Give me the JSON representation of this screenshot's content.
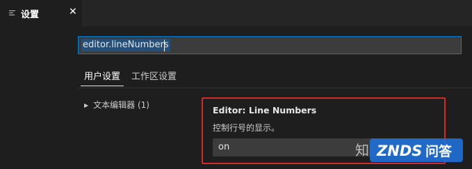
{
  "tab": {
    "title": "设置",
    "close_glyph": "✕",
    "icon": "list-icon"
  },
  "search": {
    "value": "editor.lineNumbers"
  },
  "settings_tabs": [
    {
      "label": "用户设置",
      "active": true
    },
    {
      "label": "工作区设置",
      "active": false
    }
  ],
  "toc": {
    "items": [
      {
        "label": "文本编辑器 (1)",
        "icon": "chevron-right-icon"
      }
    ]
  },
  "setting": {
    "title": "Editor: Line Numbers",
    "description": "控制行号的显示。",
    "value": "on"
  },
  "watermark": {
    "zhi_text": "知",
    "zn_text": "ZNDS问答"
  },
  "colors": {
    "background": "#1e1e1e",
    "tabbar": "#252526",
    "accent_border": "#007fd4",
    "selection": "#264f78",
    "highlight_box": "#d42a2a",
    "watermark_blue": "#1f6fd6"
  }
}
